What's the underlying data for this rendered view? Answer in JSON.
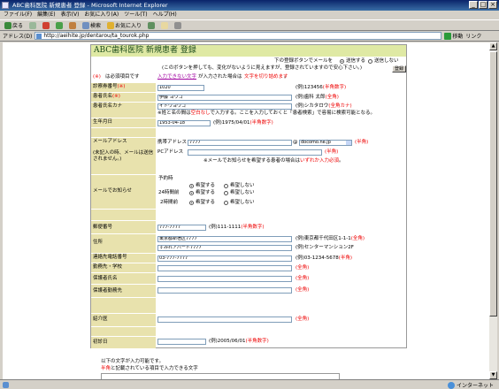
{
  "window": {
    "title": "ABC歯科医院 新規患者 登録 - Microsoft Internet Explorer"
  },
  "menu": [
    "ファイル(F)",
    "編集(E)",
    "表示(V)",
    "お気に入り(A)",
    "ツール(T)",
    "ヘルプ(H)"
  ],
  "toolbar": {
    "back": "戻る",
    "search": "検索",
    "favorites": "お気に入り"
  },
  "address": {
    "label": "アドレス(D)",
    "url": "http://aeihite.jp/dentarou/ta_tourok.php",
    "go": "移動",
    "links": "リンク"
  },
  "status": {
    "zone": "インターネット"
  },
  "form": {
    "title": "ABC歯科医院 新規患者 登録",
    "mail_note": "下の登録ボタンでメールを",
    "mail_send": "送信する",
    "mail_nosend": "送信しない",
    "warn": "(このボタンを押しても、変化がないように見えますが、登録されていますので安心下さい。)",
    "register": "登録",
    "req_mark": "(※)",
    "req_label": "は必須項目です",
    "warn_link": "入力できない文字",
    "warn_mid": "が入力された場合は",
    "warn_red": "文字を切り詰めます",
    "warn_end": "。",
    "rows": {
      "chart": {
        "label": "診察券番号",
        "req": "(※)",
        "value": "1020",
        "hint": "(例)123456",
        "hint_red": "(半角数字)"
      },
      "name": {
        "label": "患者氏名",
        "req": "(※)",
        "value": "伊藤 ヨウコ",
        "hint": "(例)歯科 太郎",
        "hint_red": "(全角)"
      },
      "kana": {
        "label": "患者氏名カナ",
        "value": "イトウヨウコ",
        "hint": "(例)シカタロウ",
        "hint_red": "(全角カナ)",
        "note_pre": "※姓と名の間は",
        "note_red": "空白なし",
        "note_post": "で入力する。ここを入力しておくと「患者検索」で容易に検索可能となる。"
      },
      "birth": {
        "label": "生年月日",
        "value": "1953-04-18",
        "hint": "(例)1975/04/01",
        "hint_red": "(半角数字)"
      },
      "email": {
        "label": "メールアドレス",
        "sub": "(未記入の時、メールは送信されません。)",
        "mobile_label": "携帯アドレス",
        "mobile_value": "7777",
        "domain": "docomo.ne.jp",
        "hint_red": "(半角)",
        "pc_label": "PCアドレス",
        "note_pre": "※メールでお知らせを希望する患者の場合は",
        "note_red": "いずれか入力必須",
        "note_end": "。"
      },
      "notice": {
        "label": "メールでお知らせ",
        "r1": "予約時",
        "r2": "24時間前",
        "r3": "2時間前",
        "yes": "希望する",
        "no": "希望しない"
      },
      "zip": {
        "label": "郵便番号",
        "value": "777-7777",
        "hint": "(例)111-1111",
        "hint_red": "(半角数字)"
      },
      "address": {
        "label": "住所",
        "line1": "東京都新宿区7777",
        "hint1": "(例)東京都千代田区1-1-1",
        "hint1_red": "(全角)",
        "line2": "すみれアパート7777",
        "hint2": "(例)センターマンション2F"
      },
      "phone": {
        "label": "連絡先電話番号",
        "value": "03-777-7777",
        "hint": "(例)03-1234-5678",
        "hint_red": "(半角)"
      },
      "work": {
        "label": "勤務先・学校",
        "hint_red": "(全角)"
      },
      "guardian": {
        "label": "保護者氏名",
        "hint_red": "(全角)"
      },
      "guardian_work": {
        "label": "保護者勤務先",
        "hint_red": "(全角)"
      },
      "referral": {
        "label": "紹介医",
        "hint_red": "(全角)"
      },
      "first_visit": {
        "label": "初診日",
        "hint": "(例)2005/06/01",
        "hint_red": "(半角数字)"
      }
    }
  },
  "footer": {
    "line1": "以下の文字が入力可能です。",
    "line2_red": "半角",
    "line2": "と記載されている項目で入力できる文字"
  }
}
